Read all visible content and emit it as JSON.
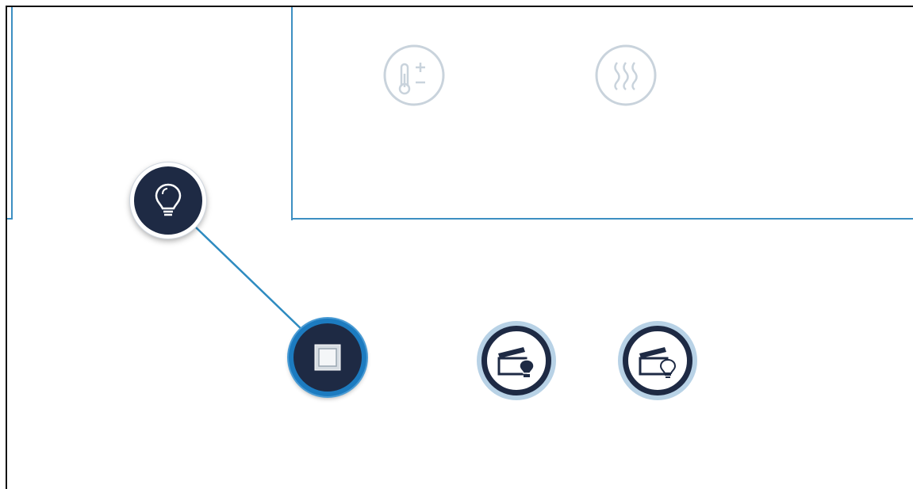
{
  "colors": {
    "frame": "#111111",
    "room_outline": "#3d8fc2",
    "dark_button": "#1e2a44",
    "selected_ring": "#1c7bc0",
    "scene_halo": "#b8d2e6",
    "faded_icon": "#c9d3dc"
  },
  "icons": {
    "faded": [
      "thermometer-plus-minus-icon",
      "heating-waves-icon"
    ],
    "bulb": "lightbulb-icon",
    "switch": "switch-icon",
    "scenes": [
      "scene-clapper-bulb-filled-icon",
      "scene-clapper-bulb-outline-icon"
    ]
  },
  "state": {
    "selected": "switch-button",
    "linked": [
      "lightbulb-button",
      "switch-button"
    ]
  }
}
